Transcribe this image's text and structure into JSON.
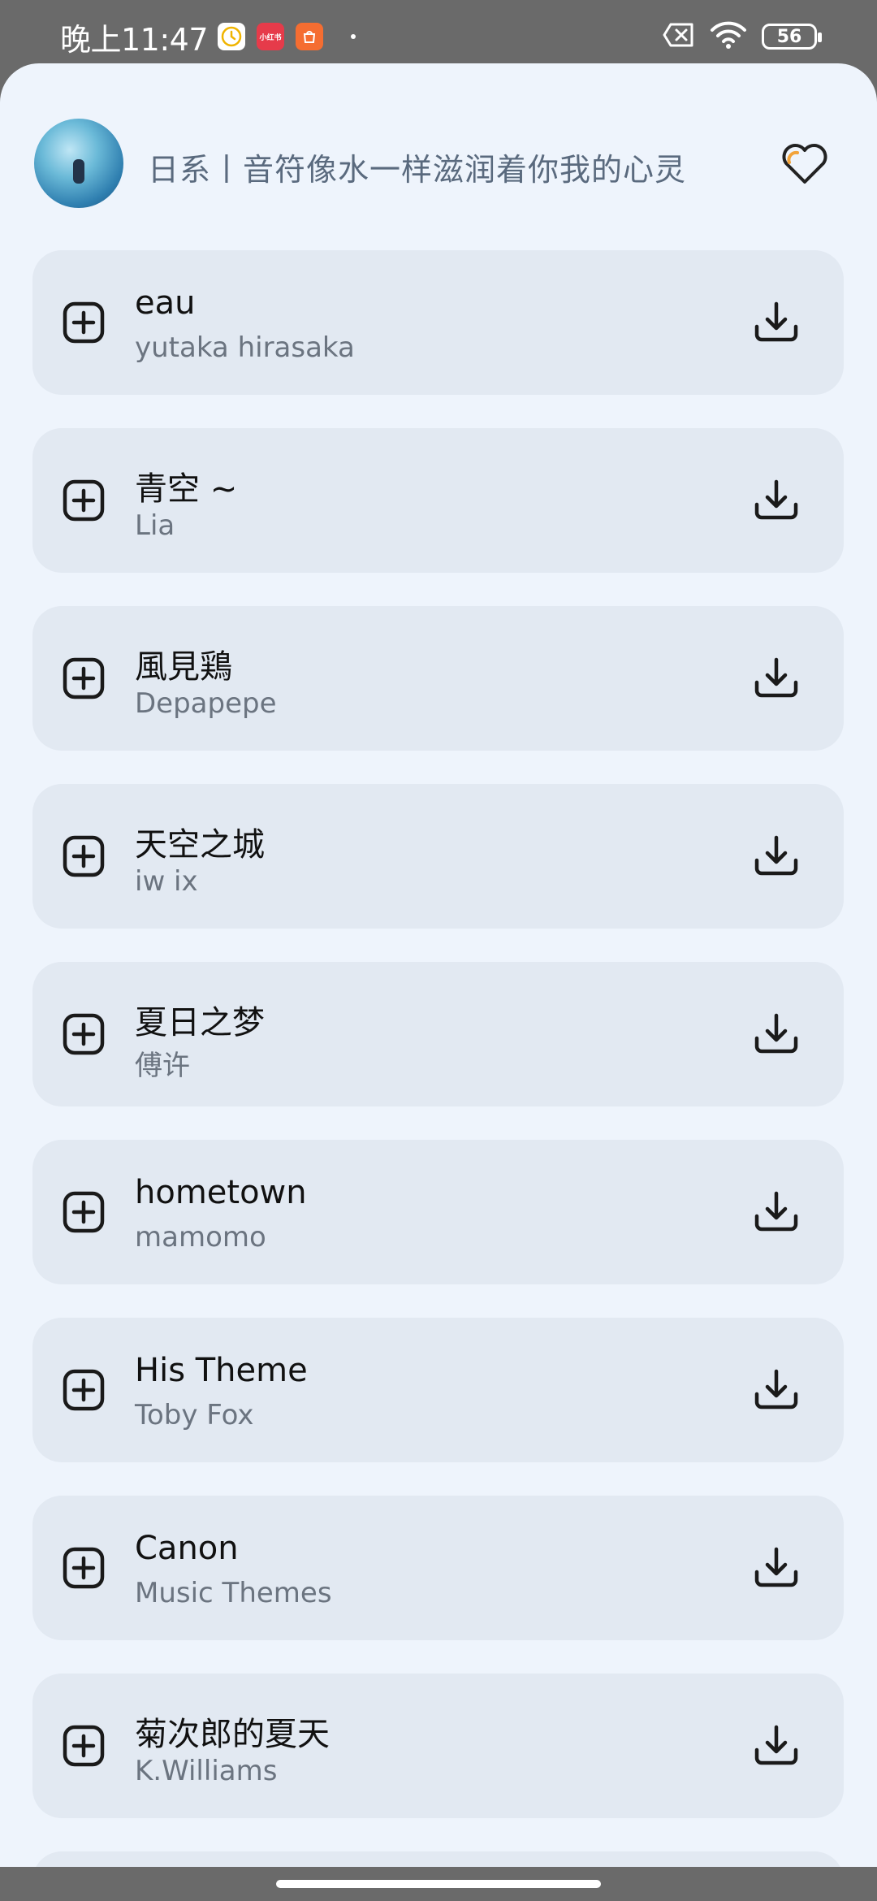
{
  "status": {
    "time": "晚上11:47",
    "battery": "56",
    "app2_label": "小红书"
  },
  "header": {
    "playlist_title": "日系丨音符像水一样滋润着你我的心灵"
  },
  "songs": [
    {
      "title": "eau",
      "artist": "yutaka hirasaka"
    },
    {
      "title": "青空 ~",
      "artist": "Lia"
    },
    {
      "title": "風見鶏",
      "artist": "Depapepe"
    },
    {
      "title": "天空之城",
      "artist": "iw ix"
    },
    {
      "title": "夏日之梦",
      "artist": "傅许"
    },
    {
      "title": "hometown",
      "artist": "mamomo"
    },
    {
      "title": "His Theme",
      "artist": "Toby Fox"
    },
    {
      "title": "Canon",
      "artist": "Music Themes"
    },
    {
      "title": "菊次郎的夏天",
      "artist": "K.Williams"
    }
  ],
  "icons": {
    "add": "add-square-icon",
    "download": "download-icon",
    "favorite": "heart-icon"
  },
  "colors": {
    "sheet_bg": "#eef4fc",
    "card_bg": "#e2e9f2",
    "heart_accent": "#f2a33a"
  }
}
